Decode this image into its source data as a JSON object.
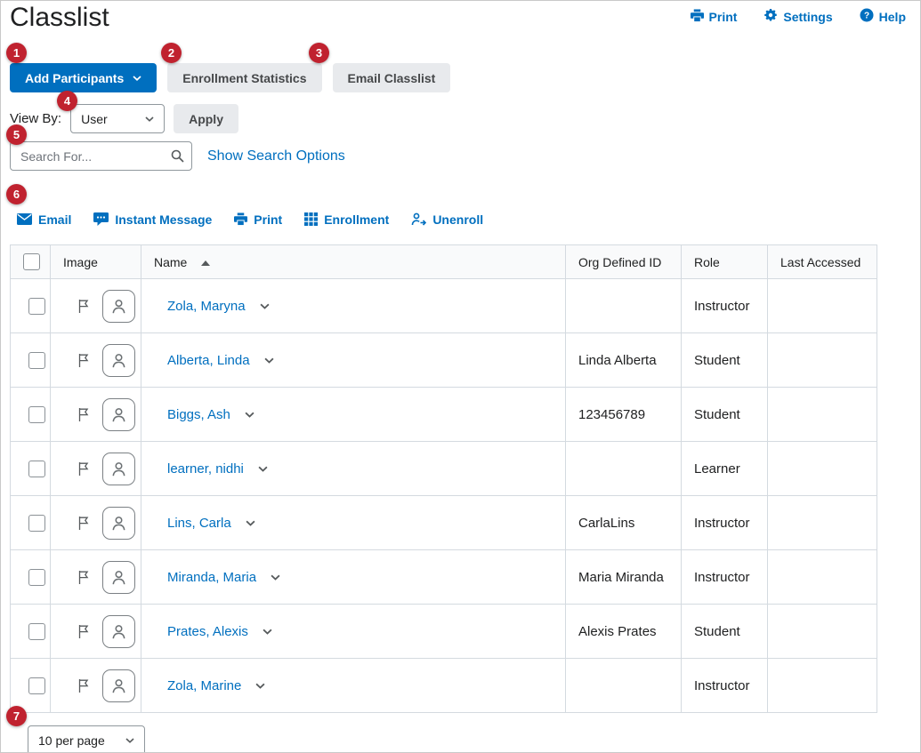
{
  "colors": {
    "link_blue": "#006fbf",
    "primary_button_bg": "#006fbf",
    "badge_red": "#c0222f",
    "table_border": "#d4dae0"
  },
  "page": {
    "title": "Classlist"
  },
  "header": {
    "links": [
      {
        "label": "Print",
        "icon": "print-icon"
      },
      {
        "label": "Settings",
        "icon": "gear-icon"
      },
      {
        "label": "Help",
        "icon": "help-icon"
      }
    ]
  },
  "annotations": [
    "1",
    "2",
    "3",
    "4",
    "5",
    "6",
    "7"
  ],
  "actions": {
    "add_participants": "Add Participants",
    "enrollment_statistics": "Enrollment Statistics",
    "email_classlist": "Email Classlist"
  },
  "view_by": {
    "label": "View By:",
    "selected_option": "User",
    "apply_label": "Apply"
  },
  "search": {
    "placeholder": "Search For...",
    "show_search_options": "Show Search Options"
  },
  "toolbar": {
    "items": [
      {
        "label": "Email",
        "icon": "email-icon"
      },
      {
        "label": "Instant Message",
        "icon": "instant-message-icon"
      },
      {
        "label": "Print",
        "icon": "print-icon"
      },
      {
        "label": "Enrollment",
        "icon": "enrollment-icon"
      },
      {
        "label": "Unenroll",
        "icon": "unenroll-icon"
      }
    ]
  },
  "table": {
    "headers": {
      "image": "Image",
      "name": "Name",
      "org_defined_id": "Org Defined ID",
      "role": "Role",
      "last_accessed": "Last Accessed"
    },
    "rows": [
      {
        "name": "Zola, Maryna",
        "org_defined_id": "",
        "role": "Instructor",
        "last_accessed": ""
      },
      {
        "name": "Alberta, Linda",
        "org_defined_id": "Linda Alberta",
        "role": "Student",
        "last_accessed": ""
      },
      {
        "name": "Biggs, Ash",
        "org_defined_id": "123456789",
        "role": "Student",
        "last_accessed": ""
      },
      {
        "name": "learner, nidhi",
        "org_defined_id": "",
        "role": "Learner",
        "last_accessed": ""
      },
      {
        "name": "Lins, Carla",
        "org_defined_id": "CarlaLins",
        "role": "Instructor",
        "last_accessed": ""
      },
      {
        "name": "Miranda, Maria",
        "org_defined_id": "Maria Miranda",
        "role": "Instructor",
        "last_accessed": ""
      },
      {
        "name": "Prates, Alexis",
        "org_defined_id": "Alexis Prates",
        "role": "Student",
        "last_accessed": ""
      },
      {
        "name": "Zola, Marine",
        "org_defined_id": "",
        "role": "Instructor",
        "last_accessed": ""
      }
    ]
  },
  "pagination": {
    "per_page": "10 per page"
  }
}
